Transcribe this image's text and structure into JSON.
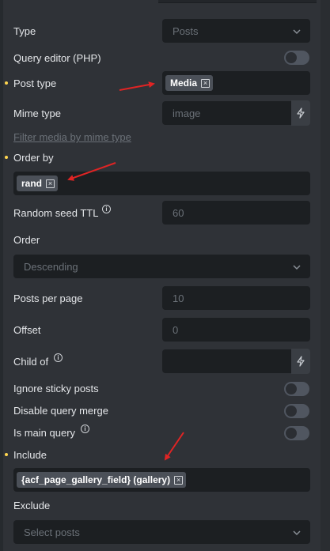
{
  "fields": {
    "type": {
      "label": "Type",
      "value": "Posts"
    },
    "query_editor": {
      "label": "Query editor (PHP)"
    },
    "post_type": {
      "label": "Post type",
      "tag": "Media"
    },
    "mime_type": {
      "label": "Mime type",
      "placeholder": "image"
    },
    "filter_link": "Filter media by mime type",
    "order_by": {
      "label": "Order by",
      "tag": "rand"
    },
    "random_seed": {
      "label": "Random seed TTL",
      "placeholder": "60"
    },
    "order": {
      "label": "Order",
      "value": "Descending"
    },
    "posts_per_page": {
      "label": "Posts per page",
      "placeholder": "10"
    },
    "offset": {
      "label": "Offset",
      "placeholder": "0"
    },
    "child_of": {
      "label": "Child of"
    },
    "ignore_sticky": {
      "label": "Ignore sticky posts"
    },
    "disable_merge": {
      "label": "Disable query merge"
    },
    "is_main_query": {
      "label": "Is main query"
    },
    "include": {
      "label": "Include",
      "tag": "{acf_page_gallery_field} (gallery)"
    },
    "exclude": {
      "label": "Exclude",
      "placeholder": "Select posts"
    }
  },
  "info_glyph": "i",
  "remove_glyph": "×",
  "icons": [
    "chevron-down-icon",
    "bolt-icon",
    "info-icon",
    "remove-tag-icon",
    "annotation-arrow"
  ],
  "colors": {
    "panel": "#2f3237",
    "input": "#1c1f22",
    "accent_dot": "#ffd64f",
    "annotation": "#e02424"
  }
}
